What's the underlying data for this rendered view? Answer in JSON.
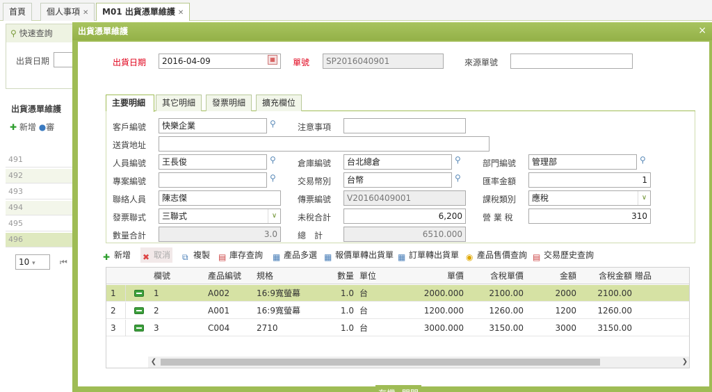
{
  "top_tabs": [
    {
      "label": "首頁",
      "closable": false
    },
    {
      "label": "個人事項",
      "closable": true
    },
    {
      "label": "M01 出貨憑單維護",
      "closable": true
    }
  ],
  "background": {
    "quick_search_label": "快速查詢",
    "ship_date_label": "出貨日期",
    "section_title": "出貨憑單維護",
    "add_label": "新增",
    "truncated_label": "審",
    "rows": [
      "491",
      "492",
      "493",
      "494",
      "495",
      "496"
    ],
    "page_size": "10"
  },
  "modal": {
    "title": "出貨憑單維護",
    "close_glyph": "×",
    "header": {
      "ship_date_label": "出貨日期",
      "ship_date_value": "2016-04-09",
      "order_no_label": "單號",
      "order_no_value": "SP2016040901",
      "source_no_label": "來源單號",
      "source_no_value": ""
    },
    "tabs": [
      "主要明細",
      "其它明細",
      "發票明細",
      "擴充欄位"
    ],
    "form": {
      "customer_label": "客戶編號",
      "customer_value": "快樂企業",
      "notes_label": "注意事項",
      "notes_value": "",
      "address_label": "送貨地址",
      "address_value": "",
      "staff_label": "人員編號",
      "staff_value": "王長俊",
      "warehouse_label": "倉庫編號",
      "warehouse_value": "台北總倉",
      "dept_label": "部門編號",
      "dept_value": "管理部",
      "project_label": "專案編號",
      "project_value": "",
      "currency_label": "交易幣別",
      "currency_value": "台幣",
      "rate_label": "匯率金額",
      "rate_value": "1",
      "contact_label": "聯絡人員",
      "contact_value": "陳志傑",
      "voucher_label": "傳票編號",
      "voucher_value": "V20160409001",
      "tax_type_label": "課稅類別",
      "tax_type_value": "應稅",
      "invoice_type_label": "發票聯式",
      "invoice_type_value": "三聯式",
      "pretax_label": "未稅合計",
      "pretax_value": "6,200",
      "vat_label": "營 業 稅",
      "vat_value": "310",
      "qty_total_label": "數量合計",
      "qty_total_value": "3.0",
      "grand_total_label": "總　計",
      "grand_total_value": "6510.000"
    },
    "toolbar": [
      {
        "label": "新增",
        "icon": "plus-icon",
        "disabled": false
      },
      {
        "label": "取消",
        "icon": "x-icon",
        "disabled": true
      },
      {
        "label": "複製",
        "icon": "copy-icon",
        "disabled": false
      },
      {
        "label": "庫存查詢",
        "icon": "doc-icon",
        "disabled": false
      },
      {
        "label": "產品多選",
        "icon": "list-icon",
        "disabled": false
      },
      {
        "label": "報價單轉出貨單",
        "icon": "list-icon",
        "disabled": false
      },
      {
        "label": "訂單轉出貨單",
        "icon": "list-icon",
        "disabled": false
      },
      {
        "label": "產品售價查詢",
        "icon": "bulb-icon",
        "disabled": false
      },
      {
        "label": "交易歷史查詢",
        "icon": "doc-icon",
        "disabled": false
      }
    ],
    "grid": {
      "columns": [
        "欄號",
        "產品編號",
        "規格",
        "數量",
        "單位",
        "單價",
        "含稅單價",
        "金額",
        "含稅金額",
        "贈品"
      ],
      "rows": [
        {
          "num": "1",
          "seq": "1",
          "product": "A002",
          "spec": "16:9寬螢幕",
          "qty": "1.0",
          "unit": "台",
          "price": "2000.000",
          "price_tax": "2100.00",
          "amount": "2000",
          "amount_tax": "2100.00",
          "gift": ""
        },
        {
          "num": "2",
          "seq": "2",
          "product": "A001",
          "spec": "16:9寬螢幕",
          "qty": "1.0",
          "unit": "台",
          "price": "1200.000",
          "price_tax": "1260.00",
          "amount": "1200",
          "amount_tax": "1260.00",
          "gift": ""
        },
        {
          "num": "3",
          "seq": "3",
          "product": "C004",
          "spec": "2710",
          "qty": "1.0",
          "unit": "台",
          "price": "3000.000",
          "price_tax": "3150.00",
          "amount": "3000",
          "amount_tax": "3150.00",
          "gift": ""
        }
      ]
    },
    "save_label": "存檔",
    "close_label": "關閉"
  },
  "colors": {
    "accent": "#9fbc55",
    "selected_row": "#d6e2a4",
    "required_label": "#e0001a"
  }
}
